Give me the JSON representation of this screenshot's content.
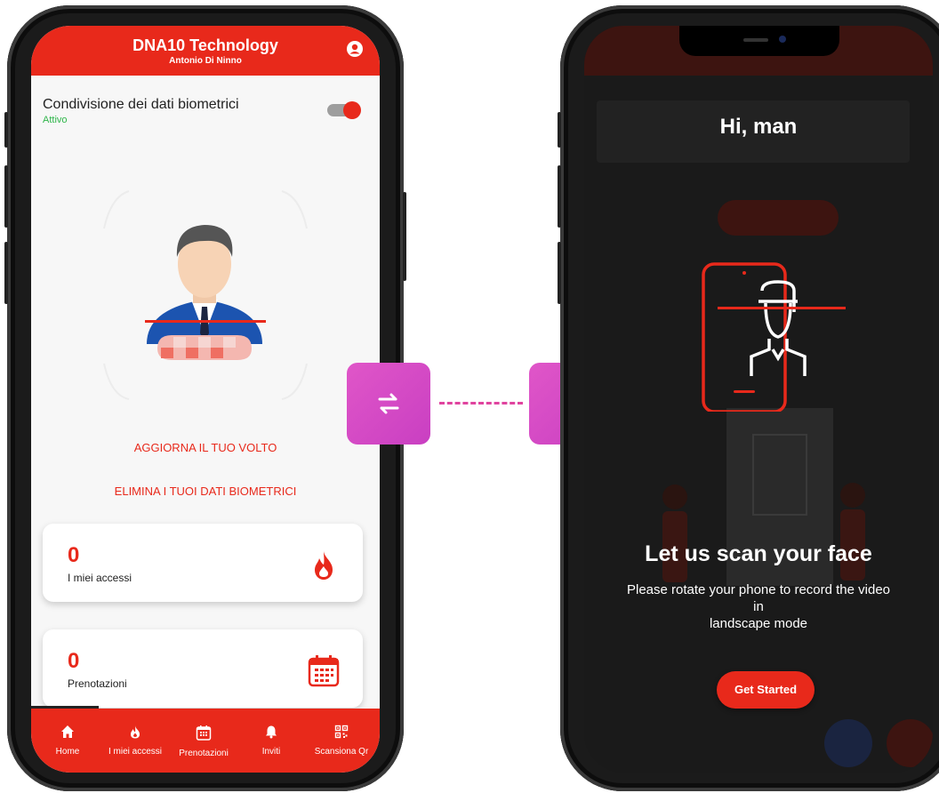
{
  "left_app": {
    "header": {
      "title": "DNA10 Technology",
      "subtitle": "Antonio Di Ninno"
    },
    "biometric": {
      "label": "Condivisione dei dati biometrici",
      "status": "Attivo",
      "toggle_on": true
    },
    "actions": {
      "update_face": "AGGIORNA IL TUO VOLTO",
      "delete_data": "ELIMINA I TUOI DATI BIOMETRICI"
    },
    "cards": [
      {
        "value": "0",
        "label": "I miei accessi",
        "icon": "flame-icon"
      },
      {
        "value": "0",
        "label": "Prenotazioni",
        "icon": "calendar-icon"
      }
    ],
    "nav": [
      {
        "label": "Home",
        "icon": "home-icon"
      },
      {
        "label": "I miei accessi",
        "icon": "flame-icon"
      },
      {
        "label": "Prenotazioni",
        "icon": "calendar-icon"
      },
      {
        "label": "Inviti",
        "icon": "bell-icon"
      },
      {
        "label": "Scansiona Qr",
        "icon": "qr-code-icon"
      }
    ]
  },
  "right_app": {
    "greeting": "Hi, man",
    "scan_title": "Let us scan your face",
    "scan_desc_1": "Please rotate your phone to record the video",
    "scan_desc_2": "in",
    "scan_desc_3": "landscape mode",
    "button": "Get Started"
  },
  "colors": {
    "brand_red": "#e8291b",
    "connector_magenta": "#d54bc5",
    "status_green": "#2fb54a"
  }
}
